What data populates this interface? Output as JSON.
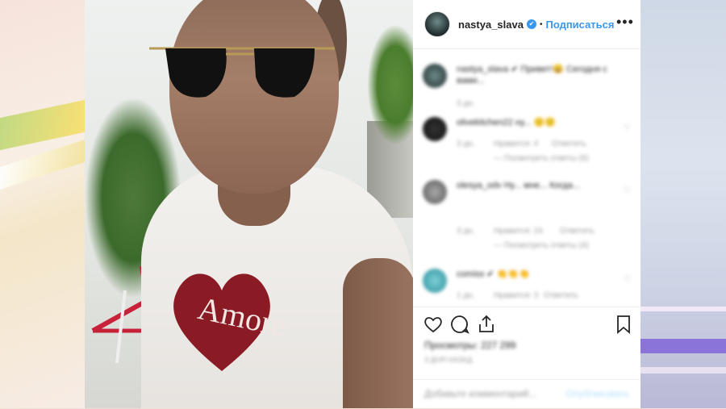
{
  "post": {
    "username": "nastya_slava",
    "verified_mark": "✔",
    "separator": "•",
    "follow_label": "Подписаться",
    "more_label": "•••"
  },
  "video": {
    "shirt_text": "Amore"
  },
  "comments": [
    {
      "text": "nastya_slava ✔ Привет!😀 Сегодня с вами...",
      "time": "3 дн."
    },
    {
      "text": "olivekitchen22 ну... 🙂🙂",
      "time": "3 дн.",
      "likes": "Нравится: 4",
      "reply": "Ответить",
      "view_replies": "— Посмотреть ответы (6)"
    },
    {
      "text": "olesya_odv Ну... мне... Когда...",
      "time": "3 дн.",
      "likes": "Нравится: 24",
      "reply": "Ответить",
      "view_replies": "— Посмотреть ответы (4)"
    },
    {
      "text": "comiss ✔ 👏👏👏",
      "time": "1 дн.",
      "likes": "Нравится: 3",
      "reply": "Ответить"
    }
  ],
  "actions": {
    "views": "Просмотры: 227 299",
    "age": "3 ДНЯ НАЗАД"
  },
  "add_comment": {
    "placeholder": "Добавьте комментарий...",
    "publish": "Опубликовать"
  },
  "colors": {
    "accent": "#3897f0",
    "text": "#262626",
    "muted": "#999999"
  }
}
